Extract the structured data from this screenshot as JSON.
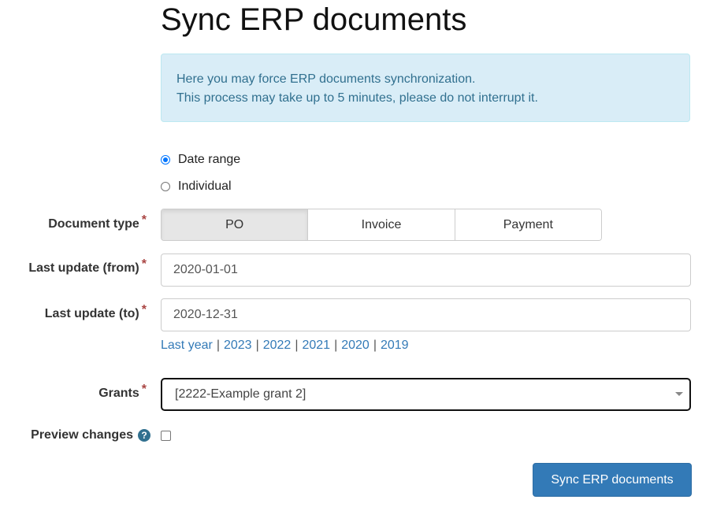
{
  "page": {
    "title": "Sync ERP documents"
  },
  "alert": {
    "line1": "Here you may force ERP documents synchronization.",
    "line2": "This process may take up to 5 minutes, please do not interrupt it."
  },
  "mode": {
    "options": [
      {
        "label": "Date range",
        "checked": true
      },
      {
        "label": "Individual",
        "checked": false
      }
    ]
  },
  "document_type": {
    "label": "Document type",
    "required_marker": "*",
    "options": [
      "PO",
      "Invoice",
      "Payment"
    ],
    "selected": "PO"
  },
  "last_update_from": {
    "label": "Last update (from)",
    "required_marker": "*",
    "value": "2020-01-01"
  },
  "last_update_to": {
    "label": "Last update (to)",
    "required_marker": "*",
    "value": "2020-12-31"
  },
  "quick_ranges": [
    "Last year",
    "2023",
    "2022",
    "2021",
    "2020",
    "2019"
  ],
  "quick_range_separator": "|",
  "grants": {
    "label": "Grants",
    "required_marker": "*",
    "value": "[2222-Example grant 2]"
  },
  "preview": {
    "label": "Preview changes",
    "help_icon": "question-circle-icon",
    "help_glyph": "?",
    "checked": false
  },
  "submit": {
    "label": "Sync ERP documents"
  },
  "colors": {
    "primary": "#337ab7",
    "info_bg": "#d9edf7",
    "info_text": "#31708f",
    "required": "#a94442"
  }
}
